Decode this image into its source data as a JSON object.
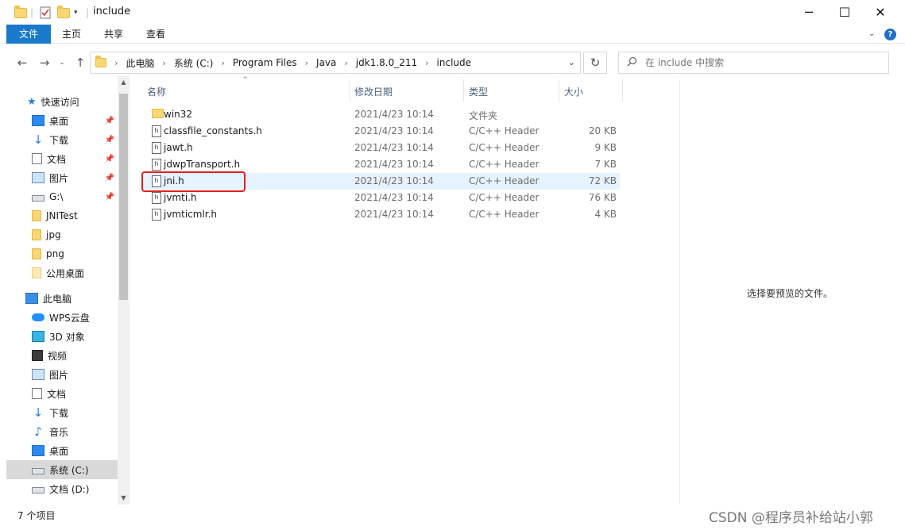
{
  "window": {
    "title": "include",
    "minimize": "─",
    "maximize": "☐",
    "close": "✕"
  },
  "ribbon": {
    "tabs": [
      "文件",
      "主页",
      "共享",
      "查看"
    ],
    "help": "?",
    "expand": "⌄"
  },
  "address": {
    "crumbs": [
      "此电脑",
      "系统 (C:)",
      "Program Files",
      "Java",
      "jdk1.8.0_211",
      "include"
    ],
    "search_placeholder": "在 include 中搜索"
  },
  "nav": {
    "quick_access": "快速访问",
    "items": [
      {
        "label": "桌面",
        "icon": "desktop-icon",
        "pinned": true
      },
      {
        "label": "下载",
        "icon": "download-icon",
        "pinned": true
      },
      {
        "label": "文档",
        "icon": "document-icon",
        "pinned": true
      },
      {
        "label": "图片",
        "icon": "picture-icon",
        "pinned": true
      },
      {
        "label": "G:\\",
        "icon": "drive-icon",
        "pinned": true
      },
      {
        "label": "JNITest",
        "icon": "folder-icon",
        "pinned": false
      },
      {
        "label": "jpg",
        "icon": "folder-icon",
        "pinned": false
      },
      {
        "label": "png",
        "icon": "folder-icon",
        "pinned": false
      },
      {
        "label": "公用桌面",
        "icon": "folder-icon",
        "pinned": false
      }
    ],
    "this_pc": "此电脑",
    "pc_items": [
      {
        "label": "WPS云盘",
        "icon": "cloud-icon"
      },
      {
        "label": "3D 对象",
        "icon": "3d-objects-icon"
      },
      {
        "label": "视频",
        "icon": "video-icon"
      },
      {
        "label": "图片",
        "icon": "picture-icon"
      },
      {
        "label": "文档",
        "icon": "document-icon"
      },
      {
        "label": "下载",
        "icon": "download-icon"
      },
      {
        "label": "音乐",
        "icon": "music-icon"
      },
      {
        "label": "桌面",
        "icon": "desktop-icon"
      },
      {
        "label": "系统 (C:)",
        "icon": "drive-icon",
        "selected": true
      },
      {
        "label": "文档 (D:)",
        "icon": "drive-icon"
      }
    ]
  },
  "columns": {
    "name": "名称",
    "modified": "修改日期",
    "type": "类型",
    "size": "大小"
  },
  "files": [
    {
      "name": "win32",
      "modified": "2021/4/23 10:14",
      "type": "文件夹",
      "size": "",
      "icon": "folder-icon"
    },
    {
      "name": "classfile_constants.h",
      "modified": "2021/4/23 10:14",
      "type": "C/C++ Header",
      "size": "20 KB",
      "icon": "header-file-icon"
    },
    {
      "name": "jawt.h",
      "modified": "2021/4/23 10:14",
      "type": "C/C++ Header",
      "size": "9 KB",
      "icon": "header-file-icon"
    },
    {
      "name": "jdwpTransport.h",
      "modified": "2021/4/23 10:14",
      "type": "C/C++ Header",
      "size": "7 KB",
      "icon": "header-file-icon"
    },
    {
      "name": "jni.h",
      "modified": "2021/4/23 10:14",
      "type": "C/C++ Header",
      "size": "72 KB",
      "icon": "header-file-icon",
      "highlighted": true
    },
    {
      "name": "jvmti.h",
      "modified": "2021/4/23 10:14",
      "type": "C/C++ Header",
      "size": "76 KB",
      "icon": "header-file-icon"
    },
    {
      "name": "jvmticmlr.h",
      "modified": "2021/4/23 10:14",
      "type": "C/C++ Header",
      "size": "4 KB",
      "icon": "header-file-icon"
    }
  ],
  "preview": "选择要预览的文件。",
  "status": "7 个项目",
  "watermark": "CSDN @程序员补给站小郭",
  "colors": {
    "accent": "#1979ca",
    "highlight_row": "#e5f3ff",
    "annotation": "#e02020"
  }
}
